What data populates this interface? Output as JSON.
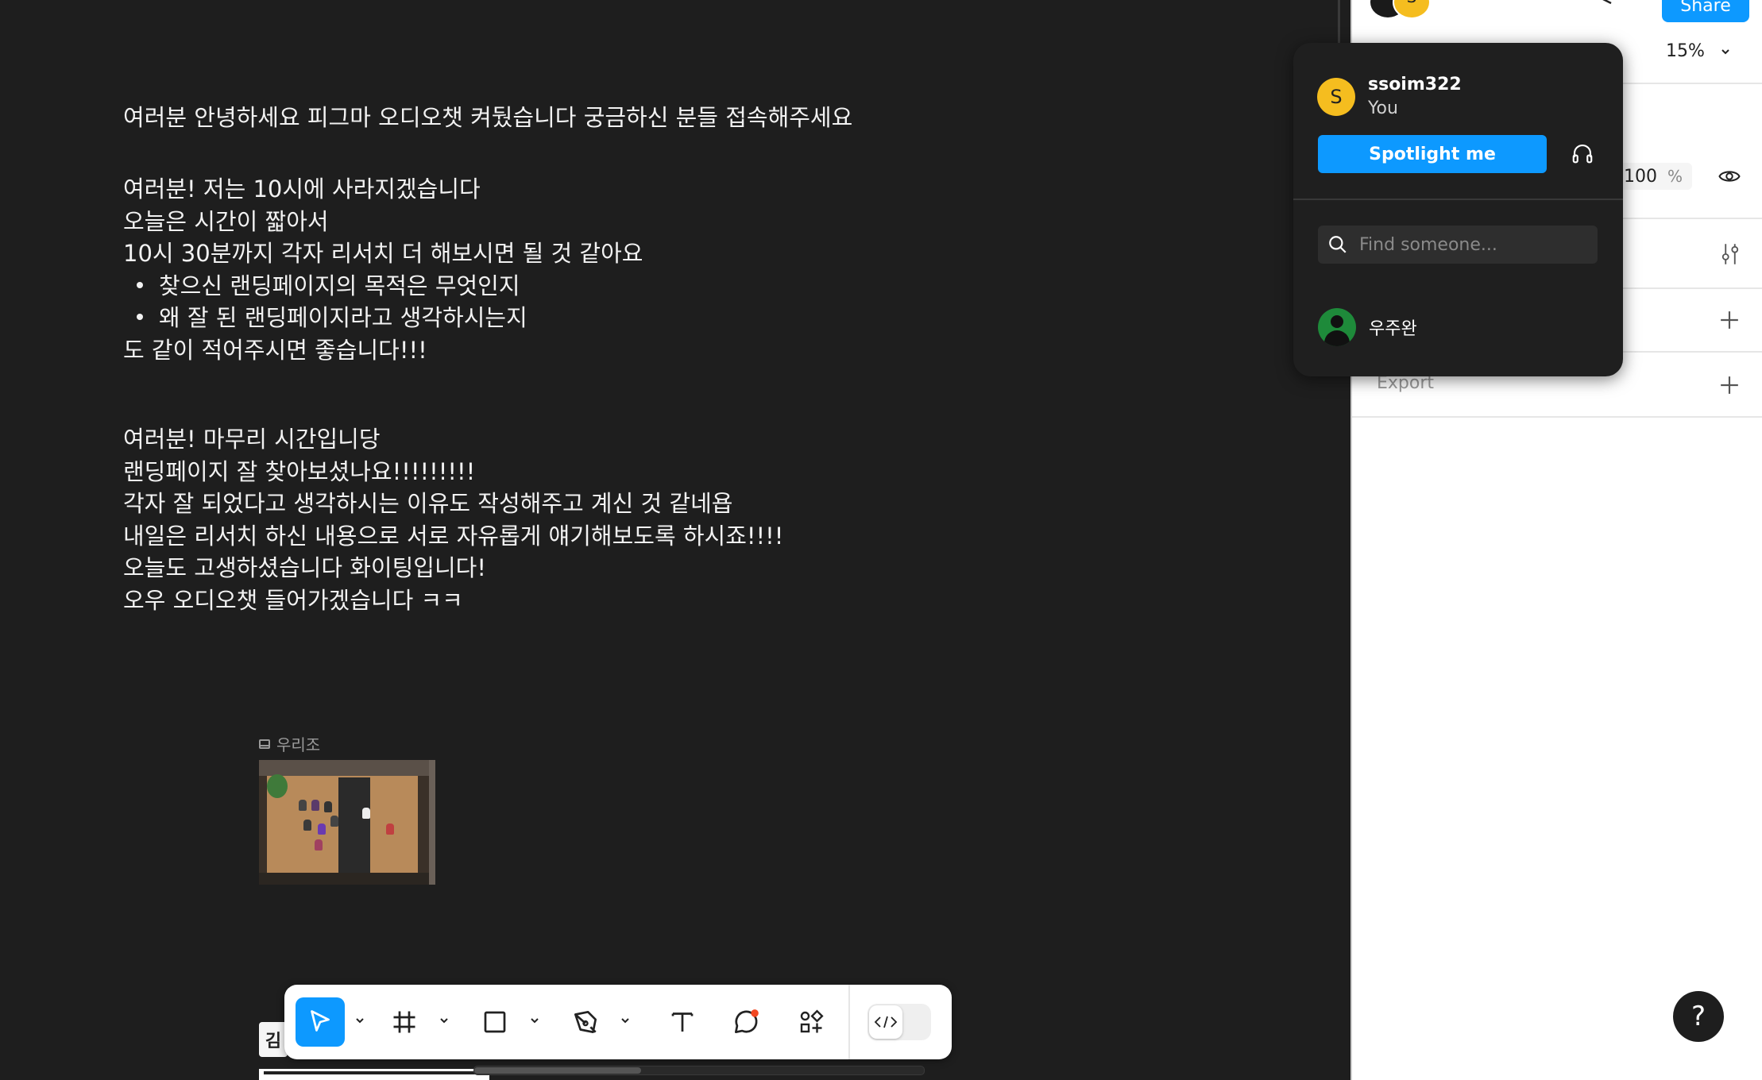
{
  "canvas": {
    "note1": [
      "여러분 안녕하세요 피그마 오디오챗 켜뒀습니다 궁금하신 분들 접속해주세요"
    ],
    "note2": {
      "lines": [
        "여러분! 저는 10시에 사라지겠습니다",
        "오늘은 시간이 짧아서",
        "10시 30분까지 각자 리서치 더 해보시면 될 것 같아요"
      ],
      "bullets": [
        "찾으신 랜딩페이지의 목적은 무엇인지",
        "왜 잘 된 랜딩페이지라고 생각하시는지"
      ],
      "closing": "도 같이 적어주시면 좋습니다!!!"
    },
    "note3": [
      "여러분! 마무리 시간입니당",
      "랜딩페이지 잘 찾아보셨나요!!!!!!!!!",
      "각자 잘 되었다고 생각하시는 이유도 작성해주고 계신 것 같네욥",
      "내일은 리서치 하신 내용으로 서로 자유롭게 얘기해보도록 하시죠!!!!",
      "오늘도 고생하셨습니다 화이팅입니다!",
      "오우 오디오챗 들어가겠습니다 ㅋㅋ"
    ],
    "frame_label": "우리조",
    "cursor_badge": "김"
  },
  "toolbar": {
    "tools": [
      "move-tool",
      "frame-tool",
      "rectangle-tool",
      "pen-tool",
      "text-tool",
      "comment-tool",
      "actions-tool"
    ],
    "active": "move-tool",
    "accent": "#0d99ff"
  },
  "header": {
    "share_label": "Share",
    "avatar_initial": "S",
    "zoom": "15%"
  },
  "panel": {
    "opacity": "100",
    "opacity_unit": "%",
    "export_label": "Export",
    "help_label": "?"
  },
  "popover": {
    "user_initial": "S",
    "user_name": "ssoim322",
    "user_sub": "You",
    "spotlight_label": "Spotlight me",
    "find_placeholder": "Find someone...",
    "people": [
      {
        "name": "우주완"
      }
    ]
  }
}
